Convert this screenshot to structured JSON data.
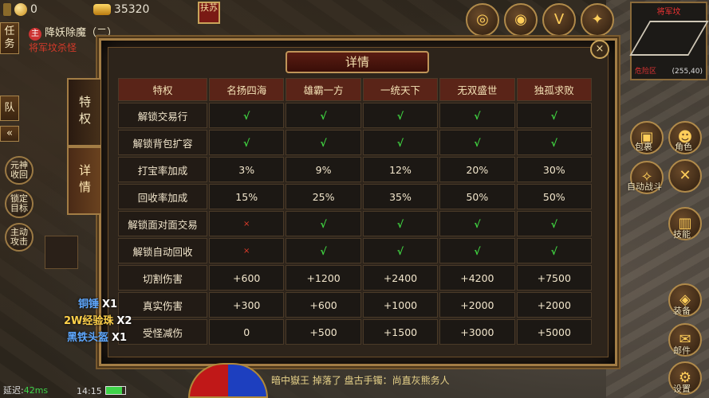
{
  "hud": {
    "ingot_count": "0",
    "gold_count": "35320",
    "event_badge": "扶苏",
    "quest_title": "降妖除魔（二）",
    "quest_desc": "将军坟杀怪"
  },
  "left_tabs": [
    "任务",
    "队"
  ],
  "left_round_buttons": [
    "元神收回",
    "锁定目标",
    "主动攻击"
  ],
  "right_buttons": [
    "包裹",
    "角色",
    "自动战斗",
    "技能",
    "装备",
    "邮件",
    "设置"
  ],
  "top_icons": [
    "首充",
    "充值",
    "VIP",
    "荣誉特权"
  ],
  "minimap": {
    "title": "将军坟",
    "location_label": "危险区",
    "coords": "(255,40)"
  },
  "panel": {
    "title": "详情",
    "close_symbol": "×",
    "tabs": [
      {
        "label": "特权",
        "active": false
      },
      {
        "label": "详情",
        "active": true
      }
    ]
  },
  "table": {
    "headers": [
      "特权",
      "名扬四海",
      "雄霸一方",
      "一统天下",
      "无双盛世",
      "独孤求败"
    ],
    "rows": [
      {
        "label": "解锁交易行",
        "values": [
          "√",
          "√",
          "√",
          "√",
          "√"
        ]
      },
      {
        "label": "解锁背包扩容",
        "values": [
          "√",
          "√",
          "√",
          "√",
          "√"
        ]
      },
      {
        "label": "打宝率加成",
        "values": [
          "3%",
          "9%",
          "12%",
          "20%",
          "30%"
        ]
      },
      {
        "label": "回收率加成",
        "values": [
          "15%",
          "25%",
          "35%",
          "50%",
          "50%"
        ]
      },
      {
        "label": "解锁面对面交易",
        "values": [
          "×",
          "√",
          "√",
          "√",
          "√"
        ]
      },
      {
        "label": "解锁自动回收",
        "values": [
          "×",
          "√",
          "√",
          "√",
          "√"
        ]
      },
      {
        "label": "切割伤害",
        "values": [
          "+600",
          "+1200",
          "+2400",
          "+4200",
          "+7500"
        ]
      },
      {
        "label": "真实伤害",
        "values": [
          "+300",
          "+600",
          "+1000",
          "+2000",
          "+2000"
        ]
      },
      {
        "label": "受怪减伤",
        "values": [
          "0",
          "+500",
          "+1500",
          "+3000",
          "+5000"
        ]
      }
    ]
  },
  "drops": [
    {
      "item": "铜锤",
      "qty": "X1",
      "color": "#5fa8ff"
    },
    {
      "item": "2W经验珠",
      "qty": "X2",
      "color": "#ffd24a"
    },
    {
      "item": "黑铁头盔",
      "qty": "X1",
      "color": "#5fa8ff"
    }
  ],
  "bottom": {
    "latency_label": "延迟:",
    "latency_value": "42ms",
    "clock": "14:15",
    "battery_level": 0.85,
    "chat": "暗中嶽王 掉落了 盘古手镯：尚直灰熊务人",
    "chat_tail": "!"
  }
}
